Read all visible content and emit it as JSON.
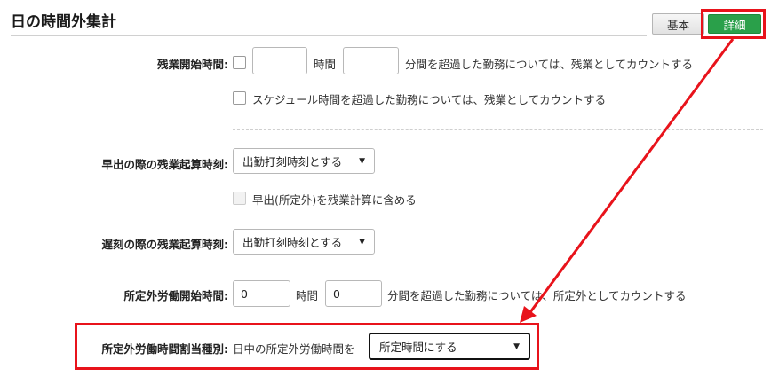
{
  "header": {
    "title": "日の時間外集計",
    "mode_basic_label": "基本",
    "mode_detail_label": "詳細"
  },
  "overtime_start": {
    "label": "残業開始時間:",
    "hours_value": "",
    "hours_unit": "時間",
    "minutes_value": "",
    "minutes_suffix": "分間を超過した勤務については、残業としてカウントする",
    "schedule_option_label": "スケジュール時間を超過した勤務については、残業としてカウントする"
  },
  "early_arrival": {
    "label": "早出の際の残業起算時刻:",
    "selected": "出勤打刻時刻とする",
    "include_checkbox_label": "早出(所定外)を残業計算に含める"
  },
  "late_arrival": {
    "label": "遅刻の際の残業起算時刻:",
    "selected": "出勤打刻時刻とする"
  },
  "nonscheduled_start": {
    "label": "所定外労働開始時間:",
    "hours_value": "0",
    "hours_unit": "時間",
    "minutes_value": "0",
    "minutes_suffix": "分間を超過した勤務については、所定外としてカウントする"
  },
  "nonscheduled_allocation": {
    "label": "所定外労働時間割当種別:",
    "prefix": "日中の所定外労働時間を",
    "selected": "所定時間にする"
  },
  "annotation": {
    "color": "#e8131b"
  }
}
